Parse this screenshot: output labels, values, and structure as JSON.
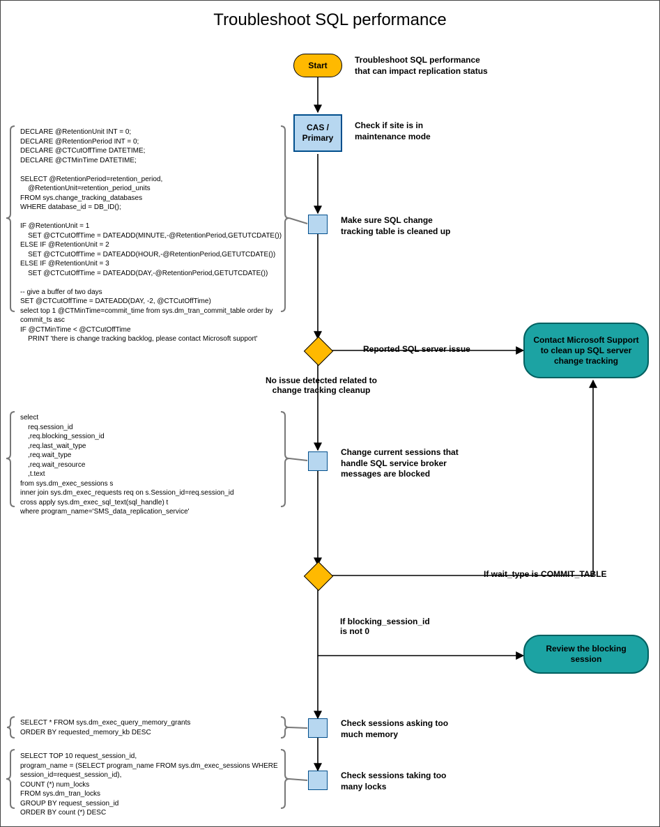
{
  "title": "Troubleshoot SQL performance",
  "nodes": {
    "start": "Start",
    "cas": "CAS /\nPrimary",
    "term1": "Contact Microsoft Support\nto clean up SQL server\nchange tracking",
    "term2": "Review the blocking session"
  },
  "labels": {
    "start_note": "Troubleshoot SQL performance\nthat can impact replication status",
    "cas_note": "Check if site is in\nmaintenance mode",
    "step_ct_cleanup": "Make sure SQL change\ntracking table is cleaned up",
    "step_sessions": "Change current sessions that\nhandle SQL service broker\nmessages are blocked",
    "step_memory": "Check sessions asking too\nmuch memory",
    "step_locks": "Check sessions taking too\nmany locks"
  },
  "edges": {
    "d1_right": "Reported SQL server issue",
    "d1_down": "No issue detected related to\nchange tracking cleanup",
    "d2_right": "If wait_type is COMMIT_TABLE",
    "d2_down": "If blocking_session_id\nis not 0"
  },
  "code": {
    "block1": "DECLARE @RetentionUnit INT = 0;\nDECLARE @RetentionPeriod INT = 0;\nDECLARE @CTCutOffTime DATETIME;\nDECLARE @CTMinTime DATETIME;\n\nSELECT @RetentionPeriod=retention_period,\n    @RetentionUnit=retention_period_units\nFROM sys.change_tracking_databases\nWHERE database_id = DB_ID();\n\nIF @RetentionUnit = 1\n    SET @CTCutOffTime = DATEADD(MINUTE,-@RetentionPeriod,GETUTCDATE())\nELSE IF @RetentionUnit = 2\n    SET @CTCutOffTime = DATEADD(HOUR,-@RetentionPeriod,GETUTCDATE())\nELSE IF @RetentionUnit = 3\n    SET @CTCutOffTime = DATEADD(DAY,-@RetentionPeriod,GETUTCDATE())\n\n-- give a buffer of two days\nSET @CTCutOffTime = DATEADD(DAY, -2, @CTCutOffTime)\nselect top 1 @CTMinTime=commit_time from sys.dm_tran_commit_table order by\ncommit_ts asc\nIF @CTMinTime < @CTCutOffTime\n    PRINT 'there is change tracking backlog, please contact Microsoft support'",
    "block2": "select\n    req.session_id\n    ,req.blocking_session_id\n    ,req.last_wait_type\n    ,req.wait_type\n    ,req.wait_resource\n    ,t.text\nfrom sys.dm_exec_sessions s\ninner join sys.dm_exec_requests req on s.Session_id=req.session_id\ncross apply sys.dm_exec_sql_text(sql_handle) t\nwhere program_name='SMS_data_replication_service'",
    "block3": "SELECT * FROM sys.dm_exec_query_memory_grants\nORDER BY requested_memory_kb DESC",
    "block4": "SELECT TOP 10 request_session_id,\nprogram_name = (SELECT program_name FROM sys.dm_exec_sessions WHERE\nsession_id=request_session_id),\nCOUNT (*) num_locks\nFROM sys.dm_tran_locks\nGROUP BY request_session_id\nORDER BY count (*) DESC"
  }
}
